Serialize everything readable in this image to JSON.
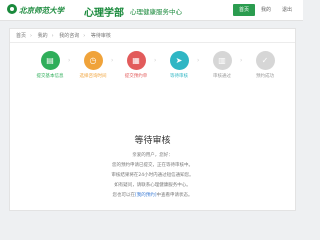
{
  "header": {
    "logo_script": "北京师范大学",
    "logo_title": "心理学部",
    "logo_sub": "心理健康服务中心",
    "nav": [
      "首页",
      "我的",
      "退出"
    ]
  },
  "breadcrumb": [
    "首页",
    "我的",
    "我的咨询",
    "等待审核"
  ],
  "steps": [
    {
      "label": "提交基本信息",
      "color": "#2fae5a",
      "icon": "id-card-icon"
    },
    {
      "label": "选择咨询时间",
      "color": "#f0a33a",
      "icon": "clock-icon"
    },
    {
      "label": "提交预约单",
      "color": "#e25b5b",
      "icon": "calendar-icon"
    },
    {
      "label": "等待审核",
      "color": "#2fb6c4",
      "icon": "send-icon"
    },
    {
      "label": "审核通过",
      "color": "#cfcfcf",
      "icon": "document-icon"
    },
    {
      "label": "预约成功",
      "color": "#cfcfcf",
      "icon": "check-icon"
    }
  ],
  "main": {
    "title": "等待审核",
    "lines": [
      "亲爱的用户，您好：",
      "您的预约申请已提交，正在等待审核中。",
      "审核结果将在24小时内通过短信通知您。",
      "如有疑问，请联系心理健康服务中心。"
    ],
    "link_prefix": "您也可以在",
    "link_text": "[我的预约]",
    "link_suffix": "中查看申请状态。"
  }
}
